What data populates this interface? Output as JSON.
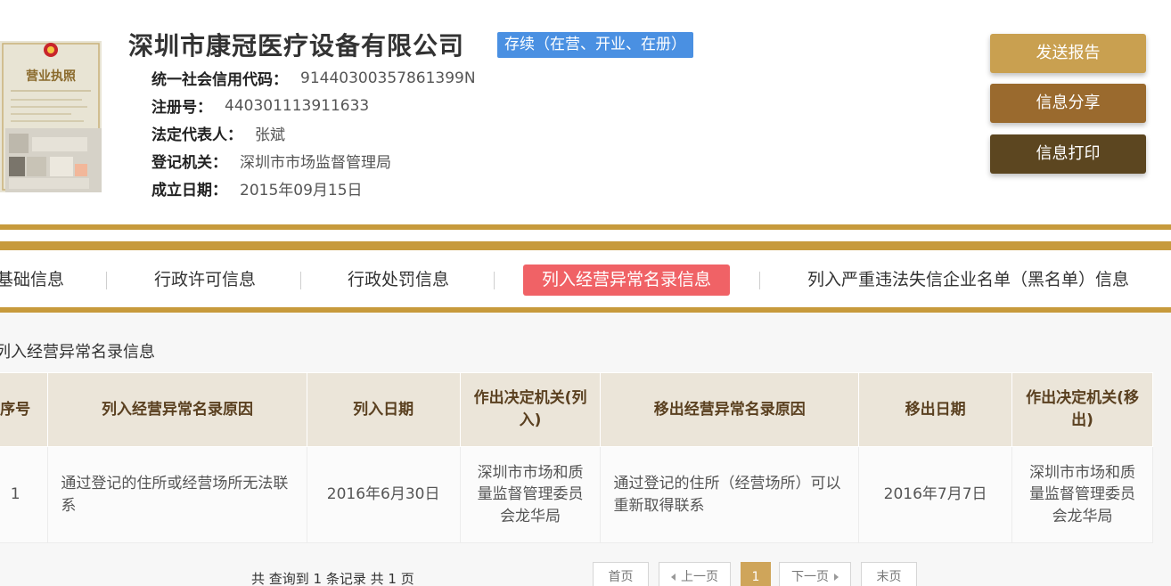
{
  "company": {
    "name": "深圳市康冠医疗设备有限公司",
    "status": "存续（在营、开业、在册）"
  },
  "license_image": {
    "title": "营业执照"
  },
  "info": [
    {
      "label": "统一社会信用代码：",
      "value": "91440300357861399N"
    },
    {
      "label": "注册号：",
      "value": "440301113911633"
    },
    {
      "label": "法定代表人：",
      "value": "张斌"
    },
    {
      "label": "登记机关：",
      "value": "深圳市市场监督管理局"
    },
    {
      "label": "成立日期：",
      "value": "2015年09月15日"
    }
  ],
  "actions": {
    "send_report": "发送报告",
    "share": "信息分享",
    "print": "信息打印"
  },
  "tabs": [
    {
      "label": "基础信息",
      "active": false
    },
    {
      "label": "行政许可信息",
      "active": false
    },
    {
      "label": "行政处罚信息",
      "active": false
    },
    {
      "label": "列入经营异常名录信息",
      "active": true
    },
    {
      "label": "列入严重违法失信企业名单（黑名单）信息",
      "active": false
    }
  ],
  "section": {
    "title": "列入经营异常名录信息"
  },
  "table": {
    "headers": [
      "序号",
      "列入经营异常名录原因",
      "列入日期",
      "作出决定机关(列入)",
      "移出经营异常名录原因",
      "移出日期",
      "作出决定机关(移出)"
    ],
    "rows": [
      [
        "1",
        "通过登记的住所或经营场所无法联系",
        "2016年6月30日",
        "深圳市市场和质量监督管理委员会龙华局",
        "通过登记的住所（经营场所）可以重新取得联系",
        "2016年7月7日",
        "深圳市市场和质量监督管理委员会龙华局"
      ]
    ]
  },
  "pagination": {
    "summary": "共 查询到 1 条记录 共 1 页",
    "first": "首页",
    "prev": "上一页",
    "current": "1",
    "next": "下一页",
    "last": "末页"
  },
  "colors": {
    "gold": "#c79a3c",
    "status_blue": "#4a90e2",
    "active_tab": "#f06266",
    "btn_send": "#c9a050",
    "btn_share": "#9a6a2e",
    "btn_print": "#5c4620"
  },
  "icons": [
    "national-emblem-icon",
    "triangle-left-icon",
    "triangle-right-icon"
  ]
}
